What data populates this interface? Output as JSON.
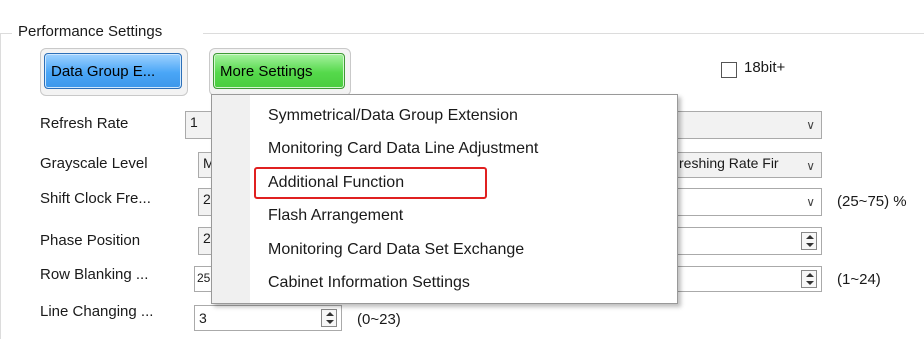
{
  "group": {
    "title": "Performance Settings"
  },
  "buttons": {
    "data_group": "Data Group E...",
    "more_settings": "More Settings"
  },
  "checkbox": {
    "label": "18bit+",
    "checked": false
  },
  "fields": [
    {
      "label": "Refresh Rate",
      "value": "1"
    },
    {
      "label": "Grayscale Level",
      "value": "M",
      "right_value": "reshing Rate Fir"
    },
    {
      "label": "Shift Clock Fre...",
      "value": "2",
      "range": "(25~75) %"
    },
    {
      "label": "Phase Position",
      "value": "2"
    },
    {
      "label": "Row Blanking ...",
      "value": "25",
      "range": "(1~24)"
    },
    {
      "label": "Line Changing ...",
      "value": "3",
      "range": "(0~23)"
    }
  ],
  "menu": {
    "items": [
      "Symmetrical/Data Group Extension",
      "Monitoring Card Data Line Adjustment",
      "Additional Function",
      "Flash Arrangement",
      "Monitoring Card Data Set Exchange",
      "Cabinet Information Settings"
    ],
    "highlighted": "Additional Function",
    "highlight_color": "#e02020"
  },
  "colors": {
    "blue_button": "#4aa6f7",
    "green_button": "#55d94b"
  }
}
